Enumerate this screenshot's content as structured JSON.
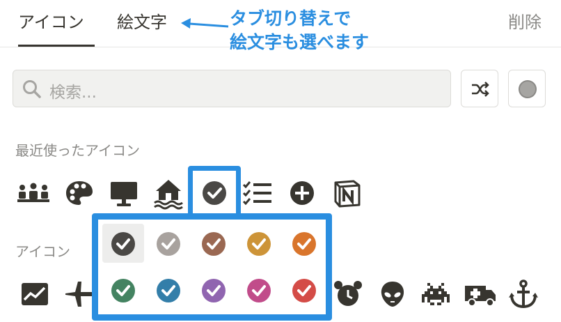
{
  "tabs": [
    {
      "label": "アイコン",
      "active": true
    },
    {
      "label": "絵文字",
      "active": false
    }
  ],
  "remove_label": "削除",
  "annotation": {
    "line1": "タブ切り替えで",
    "line2": "絵文字も選べます",
    "color": "#2a8ee0"
  },
  "search": {
    "placeholder": "検索..."
  },
  "sections": {
    "recent": "最近使ったアイコン",
    "icons": "アイコン"
  },
  "recent_icons": [
    "people-icon",
    "palette-icon",
    "desktop-icon",
    "house-flood-icon",
    "checkmark-circle-icon",
    "checklist-icon",
    "plus-circle-icon",
    "notion-logo-icon"
  ],
  "palette_colors": [
    {
      "name": "default",
      "hex": "#4a4845"
    },
    {
      "name": "gray",
      "hex": "#a8a29e"
    },
    {
      "name": "brown",
      "hex": "#9a6852"
    },
    {
      "name": "yellow",
      "hex": "#cd9438"
    },
    {
      "name": "orange",
      "hex": "#d9752c"
    },
    {
      "name": "green",
      "hex": "#448361"
    },
    {
      "name": "blue",
      "hex": "#337ea9"
    },
    {
      "name": "purple",
      "hex": "#9065b0"
    },
    {
      "name": "pink",
      "hex": "#c14c8a"
    },
    {
      "name": "red",
      "hex": "#d44c47"
    }
  ],
  "icon_row": [
    "chart-line-icon",
    "airplane-icon",
    "alarm-clock-icon",
    "alien-icon",
    "space-invader-icon",
    "ambulance-icon",
    "anchor-icon"
  ]
}
